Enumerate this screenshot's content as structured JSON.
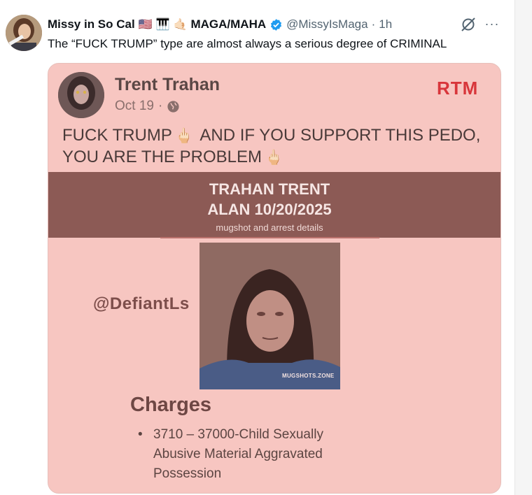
{
  "tweet": {
    "display_name": "Missy in So Cal",
    "name_suffix": "MAGA/MAHA",
    "handle": "@MissyIsMaga",
    "separator": "·",
    "time": "1h",
    "text": "The “FUCK TRUMP” type are almost always a serious degree of CRIMINAL",
    "emojis": [
      "🇺🇸",
      "🎹",
      "🤙🏻"
    ],
    "icons": [
      "verified-badge-icon",
      "grok-icon",
      "more-icon"
    ],
    "more_label": "···"
  },
  "embedded_post": {
    "author": "Trent Trahan",
    "date": "Oct 19",
    "separator": "·",
    "brand": "RTM",
    "text_line1": "FUCK TRUMP",
    "text_line1b": "AND IF YOU SUPPORT THIS PEDO,",
    "text_line2": "YOU ARE THE PROBLEM",
    "finger_emoji": "🖕🏻",
    "banner_title_line1": "TRAHAN TRENT",
    "banner_title_line2": "ALAN 10/20/2025",
    "banner_subtitle": "mugshot and arrest details",
    "watermark_handle": "@DefiantLs",
    "mugshot_watermark": "MUGSHOTS.ZONE",
    "charges_title": "Charges",
    "charges": [
      "3710 – 37000-Child Sexually Abusive Material Aggravated Possession"
    ],
    "charge_lines": [
      "3710 – 37000-Child Sexually",
      "Abusive Material Aggravated",
      "Possession"
    ]
  },
  "colors": {
    "accent_blue": "#1d9bf0",
    "post_background": "#f7c6c1",
    "banner": "#8c5a55",
    "rtm_red": "#d8363b"
  }
}
